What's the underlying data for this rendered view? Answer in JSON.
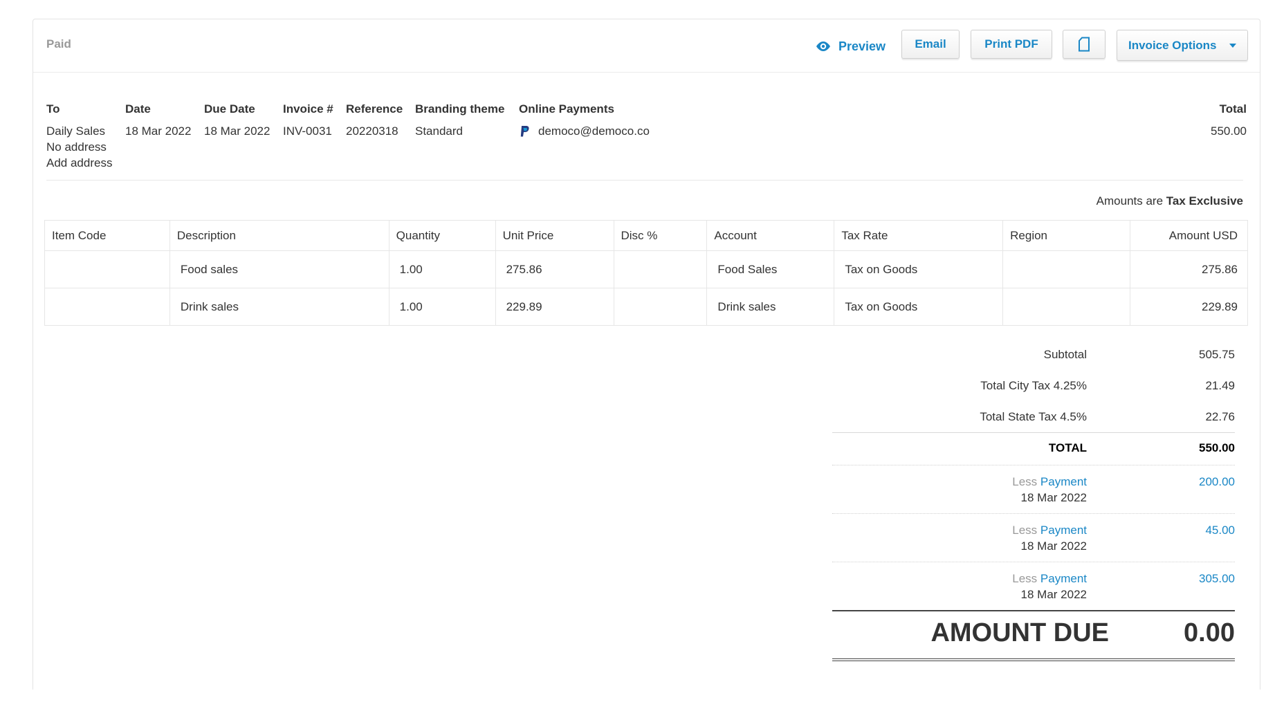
{
  "header": {
    "status": "Paid",
    "preview_label": "Preview",
    "email_label": "Email",
    "print_pdf_label": "Print PDF",
    "invoice_options_label": "Invoice Options"
  },
  "info": {
    "to_label": "To",
    "to_name": "Daily Sales",
    "to_address": "No address",
    "add_address": "Add address",
    "date_label": "Date",
    "date": "18 Mar 2022",
    "due_date_label": "Due Date",
    "due_date": "18 Mar 2022",
    "invoice_label": "Invoice #",
    "invoice_number": "INV-0031",
    "reference_label": "Reference",
    "reference": "20220318",
    "branding_label": "Branding theme",
    "branding": "Standard",
    "online_payments_label": "Online Payments",
    "online_payments_email": "democo@democo.co",
    "total_label": "Total",
    "total": "550.00"
  },
  "tax_mode": {
    "prefix": "Amounts are",
    "value": "Tax Exclusive"
  },
  "table": {
    "columns": [
      "Item Code",
      "Description",
      "Quantity",
      "Unit Price",
      "Disc %",
      "Account",
      "Tax Rate",
      "Region",
      "Amount USD"
    ],
    "rows": [
      {
        "item_code": "",
        "description": "Food sales",
        "quantity": "1.00",
        "unit_price": "275.86",
        "disc": "",
        "account": "Food Sales",
        "tax_rate": "Tax on Goods",
        "region": "",
        "amount": "275.86"
      },
      {
        "item_code": "",
        "description": "Drink sales",
        "quantity": "1.00",
        "unit_price": "229.89",
        "disc": "",
        "account": "Drink sales",
        "tax_rate": "Tax on Goods",
        "region": "",
        "amount": "229.89"
      }
    ]
  },
  "totals": {
    "subtotal_label": "Subtotal",
    "subtotal": "505.75",
    "city_tax_label": "Total City Tax 4.25%",
    "city_tax": "21.49",
    "state_tax_label": "Total State Tax 4.5%",
    "state_tax": "22.76",
    "total_label": "TOTAL",
    "total": "550.00",
    "payments": [
      {
        "less": "Less",
        "label": "Payment",
        "date": "18 Mar 2022",
        "amount": "200.00"
      },
      {
        "less": "Less",
        "label": "Payment",
        "date": "18 Mar 2022",
        "amount": "45.00"
      },
      {
        "less": "Less",
        "label": "Payment",
        "date": "18 Mar 2022",
        "amount": "305.00"
      }
    ],
    "amount_due_label": "AMOUNT DUE",
    "amount_due": "0.00"
  },
  "colors": {
    "accent": "#1a87c6",
    "muted": "#999999",
    "text": "#333333"
  }
}
